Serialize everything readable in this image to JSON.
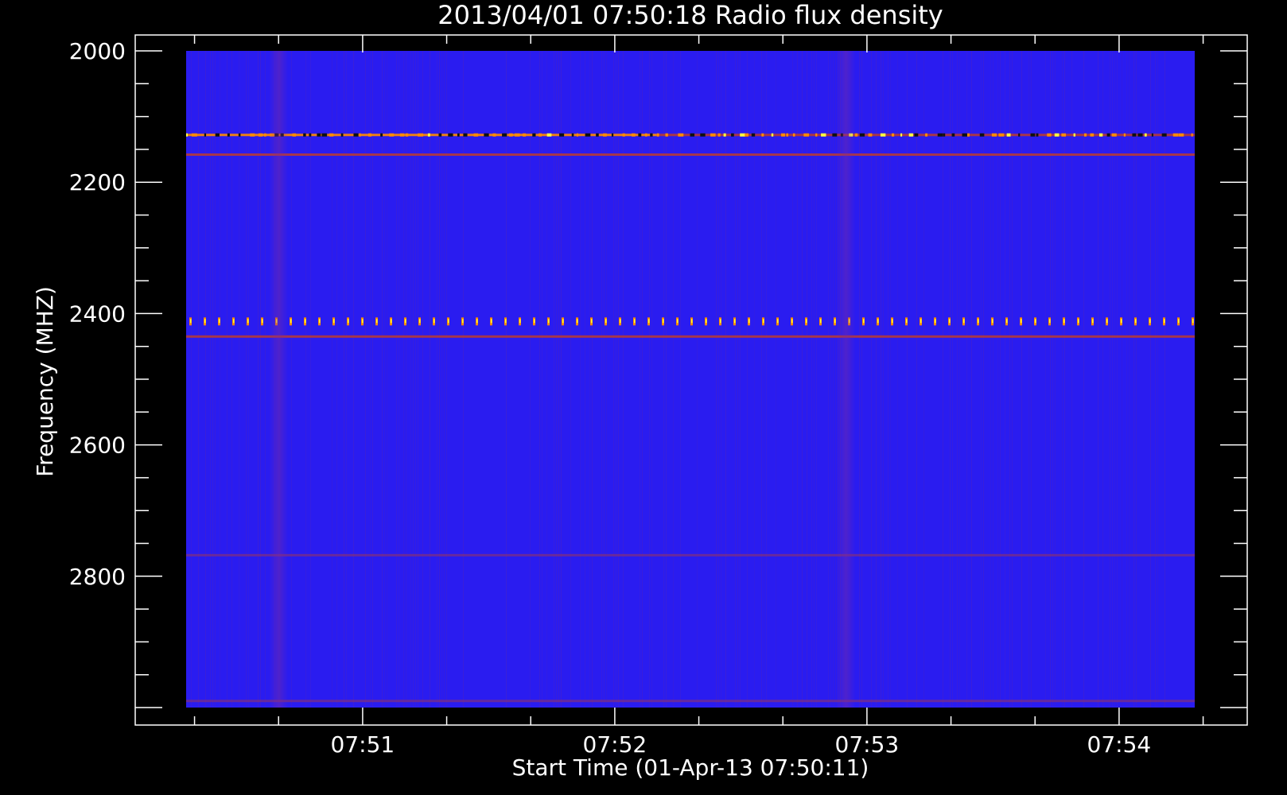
{
  "chart_data": {
    "type": "heatmap",
    "title": "2013/04/01 07:50:18 Radio flux density",
    "xlabel": "Start Time (01-Apr-13 07:50:11)",
    "ylabel": "Frequency (MHZ)",
    "x_range": [
      "07:50:18",
      "07:54:18"
    ],
    "y_range": [
      2000,
      3000
    ],
    "y_axis_inverted": true,
    "x_ticks": [
      "07:51",
      "07:52",
      "07:53",
      "07:54"
    ],
    "y_ticks": [
      2000,
      2200,
      2400,
      2600,
      2800
    ],
    "colormap": {
      "background": "#2a1cf0",
      "low": "#1c10e8",
      "mid": "#b23a3a",
      "high": "#ff8a00",
      "peak": "#ffff40"
    },
    "features": [
      {
        "kind": "horizontal-band",
        "frequency": 2128,
        "intensity": "high",
        "extent": [
          "07:50:18",
          "07:52:10"
        ]
      },
      {
        "kind": "horizontal-band",
        "frequency": 2128,
        "intensity": "mixed",
        "extent": [
          "07:52:10",
          "07:54:18"
        ]
      },
      {
        "kind": "horizontal-band",
        "frequency": 2158,
        "intensity": "medium",
        "extent": [
          "07:50:18",
          "07:54:18"
        ]
      },
      {
        "kind": "periodic-spots",
        "frequency": 2412,
        "intensity": "high",
        "extent": [
          "07:50:18",
          "07:54:18"
        ]
      },
      {
        "kind": "horizontal-band",
        "frequency": 2435,
        "intensity": "medium",
        "extent": [
          "07:50:18",
          "07:54:18"
        ]
      },
      {
        "kind": "horizontal-band",
        "frequency": 2768,
        "intensity": "low",
        "extent": [
          "07:50:18",
          "07:54:18"
        ]
      },
      {
        "kind": "horizontal-band",
        "frequency": 2990,
        "intensity": "low",
        "extent": [
          "07:50:18",
          "07:54:18"
        ]
      },
      {
        "kind": "vertical-band",
        "time": "07:50:40",
        "intensity": "low"
      },
      {
        "kind": "vertical-band",
        "time": "07:52:55",
        "intensity": "low"
      }
    ]
  }
}
